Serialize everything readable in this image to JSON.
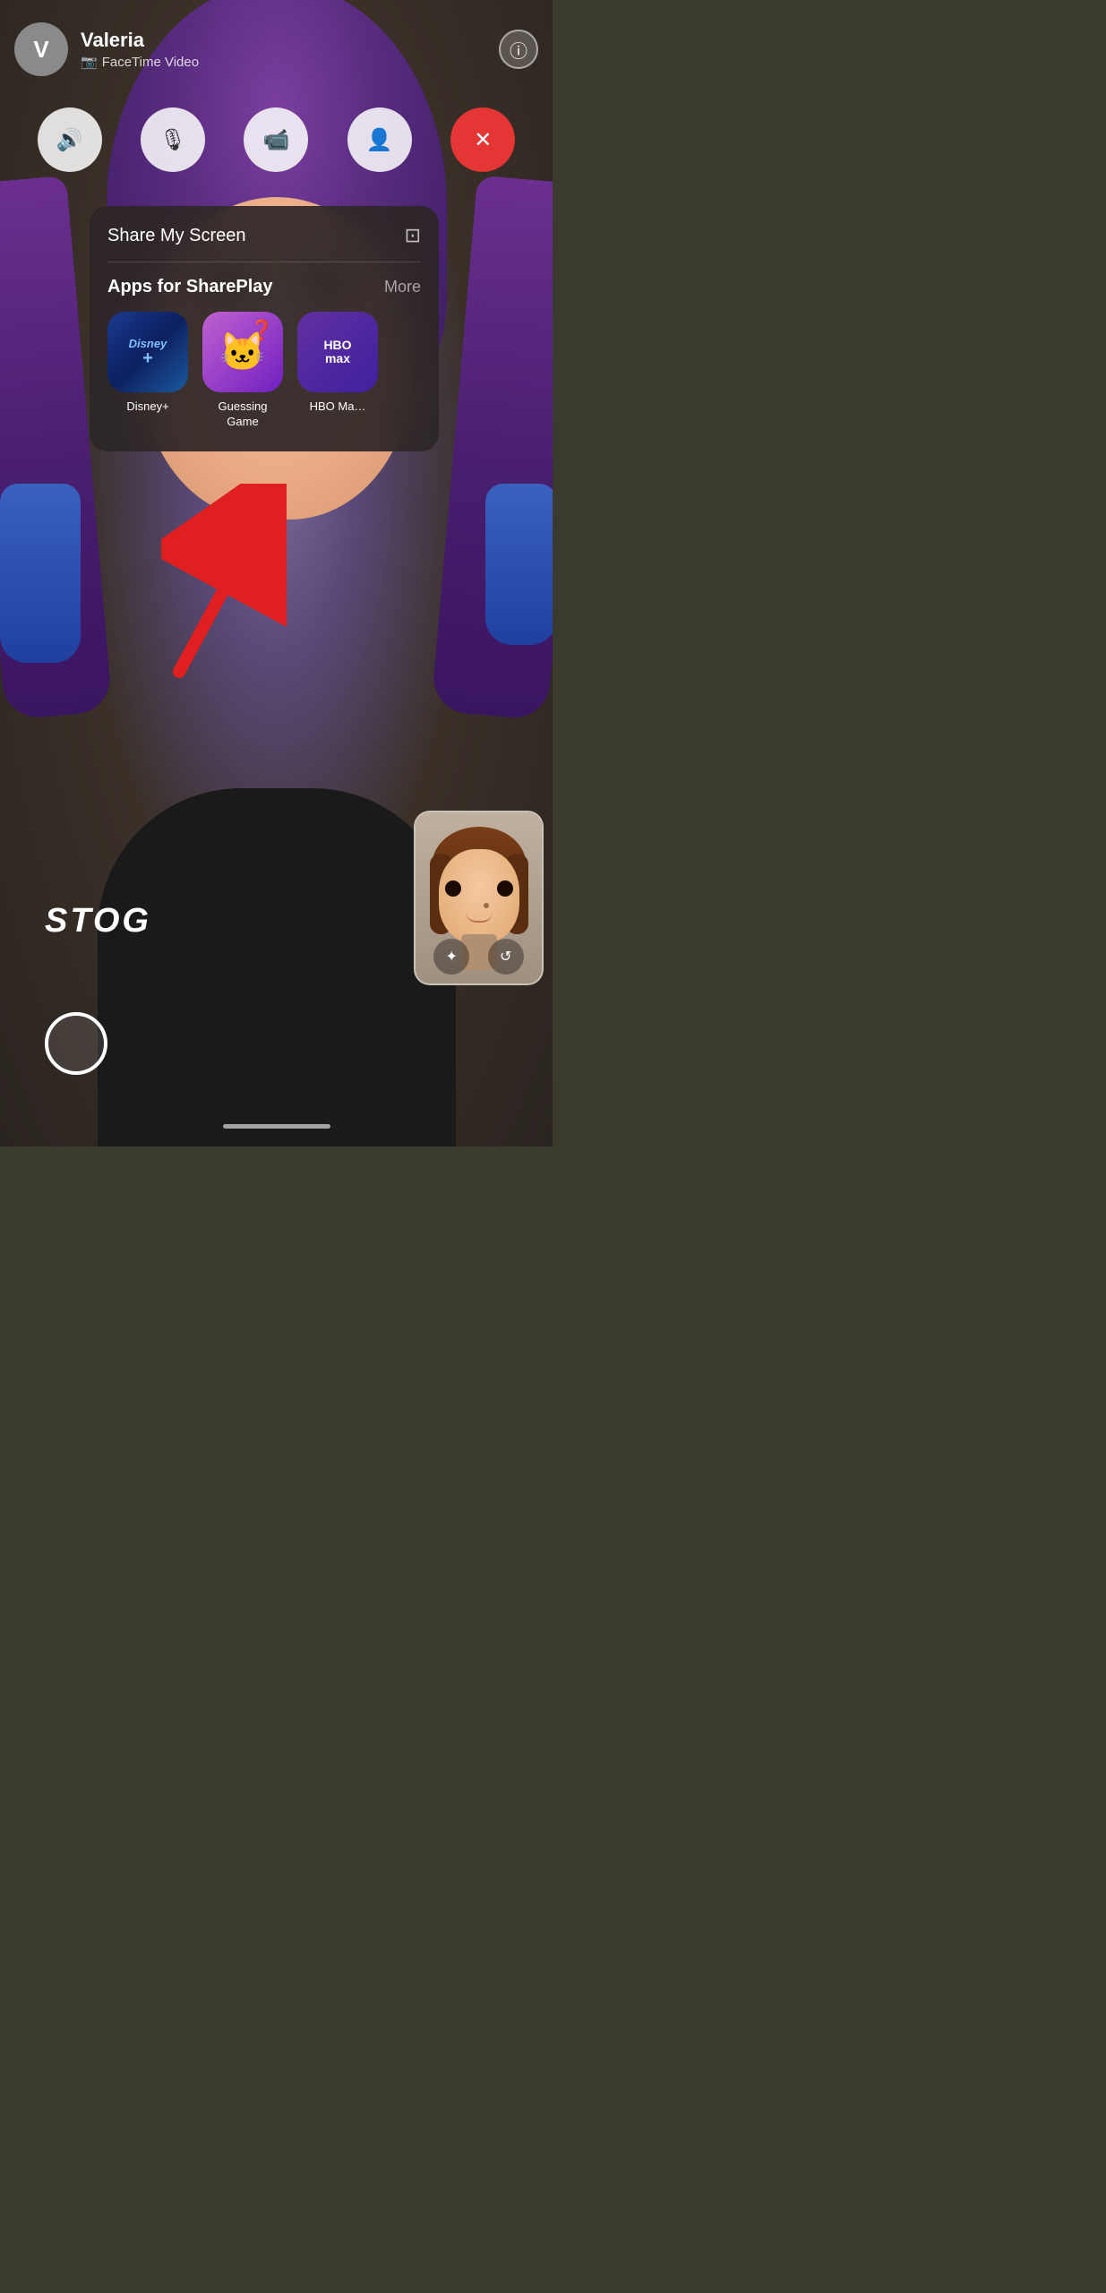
{
  "topBar": {
    "avatarInitial": "V",
    "callerName": "Valeria",
    "subtitle": "FaceTime Video",
    "infoIcon": "ⓘ"
  },
  "controls": {
    "speakerIcon": "🔊",
    "micIcon": "🎤",
    "cameraIcon": "📹",
    "shareIcon": "⊞",
    "endCallIcon": "✕"
  },
  "sharePlayPanel": {
    "shareScreenLabel": "Share My Screen",
    "shareScreenIcon": "⊡",
    "appsTitle": "Apps for SharePlay",
    "moreLabel": "More",
    "apps": [
      {
        "name": "Disney+",
        "label": "Disney+"
      },
      {
        "name": "Guessing Game",
        "label": "Guessing\nGame"
      },
      {
        "name": "HBO Max",
        "label": "HBO Ma…"
      }
    ]
  },
  "selfView": {
    "memjiIcon": "✦",
    "cameraFlipIcon": "↺"
  },
  "bottomBar": {
    "homeIndicator": ""
  }
}
